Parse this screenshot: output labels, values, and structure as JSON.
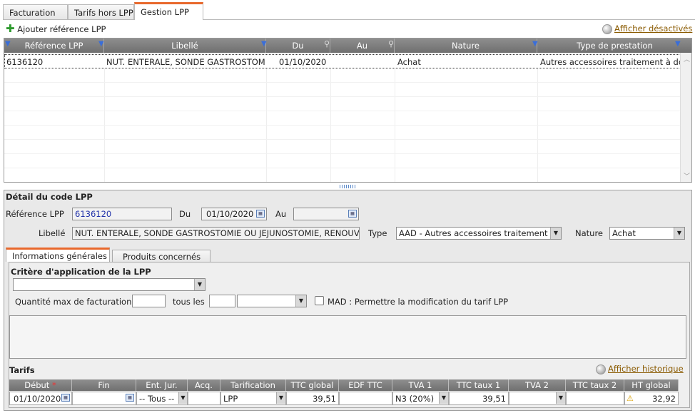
{
  "tabs": [
    {
      "label": "Facturation"
    },
    {
      "label": "Tarifs hors LPP"
    },
    {
      "label": "Gestion LPP"
    }
  ],
  "toolbar": {
    "add_label": "Ajouter référence LPP",
    "show_disabled_label": "Afficher désactivés"
  },
  "grid": {
    "columns": [
      "Référence LPP",
      "Libellé",
      "Du",
      "Au",
      "Nature",
      "Type de prestation"
    ],
    "rows": [
      {
        "ref": "6136120",
        "libelle": "NUT. ENTERALE, SONDE GASTROSTOM",
        "du": "01/10/2020",
        "au": "",
        "nature": "Achat",
        "type": "Autres accessoires traitement à do"
      }
    ]
  },
  "detail": {
    "title": "Détail du code LPP",
    "ref_label": "Référence LPP",
    "ref_value": "6136120",
    "du_label": "Du",
    "du_value": "01/10/2020",
    "au_label": "Au",
    "au_value": "",
    "libelle_label": "Libellé",
    "libelle_value": "NUT. ENTERALE, SONDE GASTROSTOMIE OU JEJUNOSTOMIE, RENOUV",
    "type_label": "Type",
    "type_value": "AAD - Autres accessoires traitement",
    "nature_label": "Nature",
    "nature_value": "Achat"
  },
  "inner_tabs": [
    {
      "label": "Informations générales"
    },
    {
      "label": "Produits concernés"
    }
  ],
  "info": {
    "critere_title": "Critère d'application de la LPP",
    "critere_value": "",
    "qty_label": "Quantité max de facturation",
    "qty_value": "",
    "every_label": "tous les",
    "every_value": "",
    "unit_value": "",
    "mad_label": "MAD : Permettre la modification du tarif LPP"
  },
  "tarifs": {
    "title": "Tarifs",
    "history_label": "Afficher historique",
    "columns": [
      "Début",
      "Fin",
      "Ent. Jur.",
      "Acq.",
      "Tarification",
      "TTC global",
      "EDF TTC",
      "TVA 1",
      "TTC taux 1",
      "TVA 2",
      "TTC taux 2",
      "HT global"
    ],
    "required_mark": "*",
    "row": {
      "debut": "01/10/2020",
      "fin": "",
      "ent_jur": "-- Tous --",
      "acq": "",
      "tarification": "LPP",
      "ttc_global": "39,51",
      "edf_ttc": "",
      "tva1": "N3 (20%)",
      "ttc_taux1": "39,51",
      "tva2": "",
      "ttc_taux2": "",
      "ht_global": "32,92"
    }
  },
  "colors": {
    "accent": "#e8682c",
    "header": "#7f7f7f",
    "link": "#8a5a00"
  }
}
